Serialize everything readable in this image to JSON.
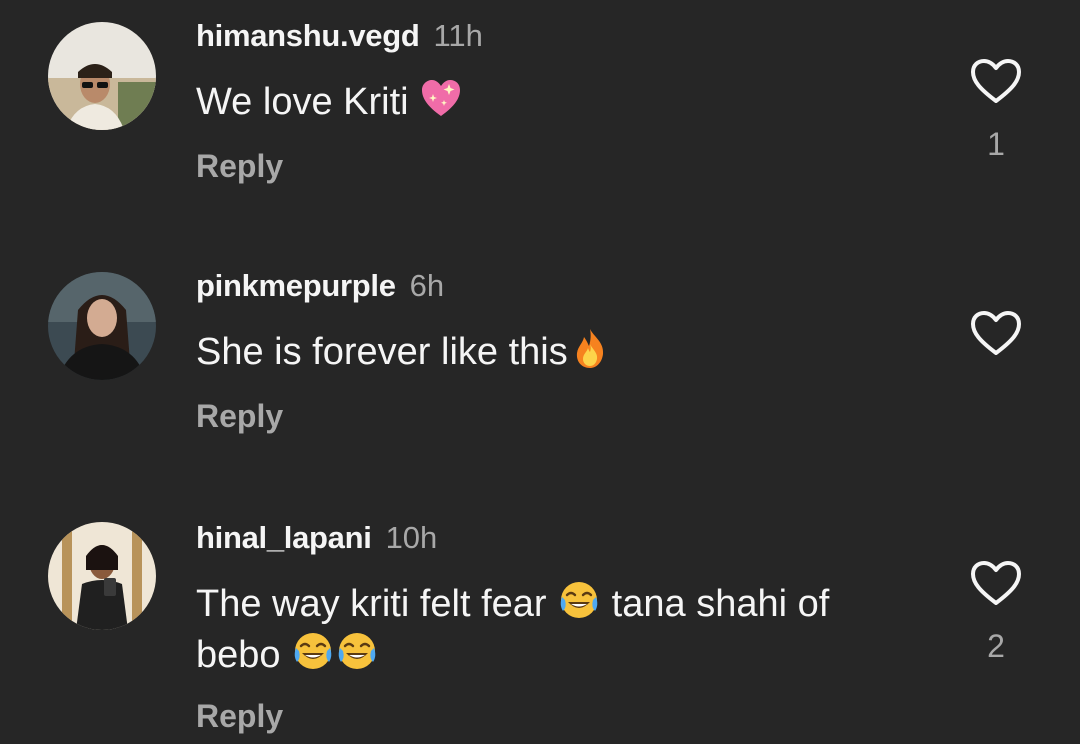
{
  "comments": [
    {
      "username": "himanshu.vegd",
      "time": "11h",
      "text": "We love Kriti ",
      "emoji": [
        "sparkling-heart"
      ],
      "reply_label": "Reply",
      "like_icon": "heart-outline-icon",
      "likes": "1"
    },
    {
      "username": "pinkmepurple",
      "time": "6h",
      "text": "She is forever like this",
      "emoji": [
        "fire"
      ],
      "reply_label": "Reply",
      "like_icon": "heart-outline-icon",
      "likes": ""
    },
    {
      "username": "hinal_lapani",
      "time": "10h",
      "text_part1": "The way kriti felt fear ",
      "text_part2": " tana shahi of",
      "text_part3": "bebo ",
      "emoji": [
        "tears-of-joy",
        "tears-of-joy",
        "tears-of-joy"
      ],
      "reply_label": "Reply",
      "like_icon": "heart-outline-icon",
      "likes": "2"
    }
  ],
  "colors": {
    "background": "#262626",
    "primary_text": "#f5f5f5",
    "secondary_text": "#a8a8a8"
  }
}
